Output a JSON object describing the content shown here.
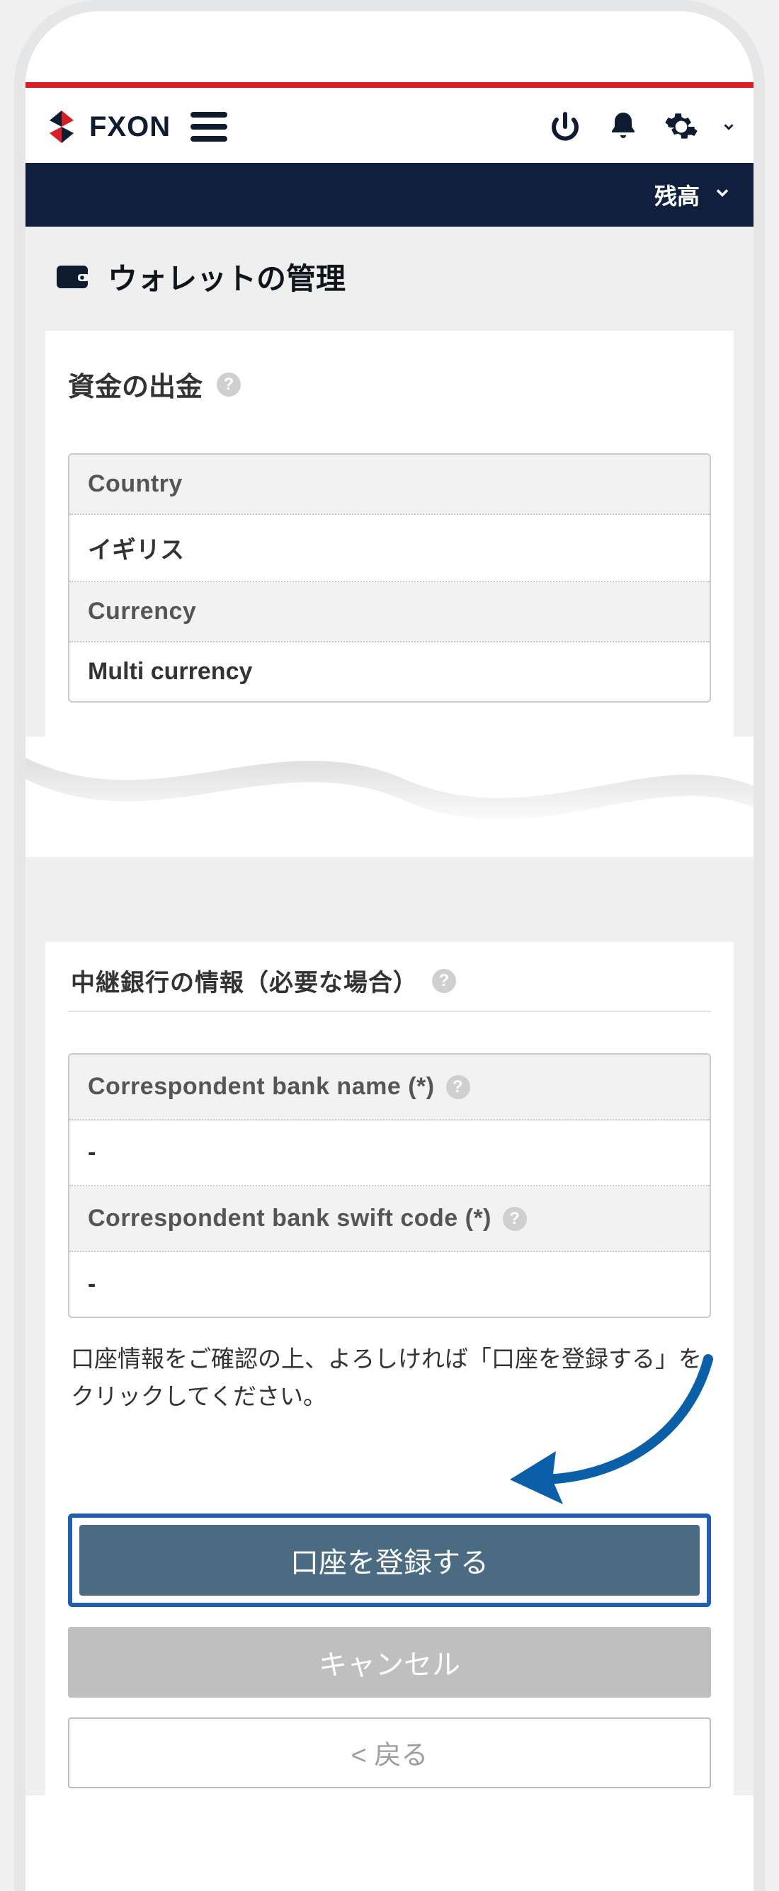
{
  "header": {
    "brand_text": "FXON",
    "balance_label": "残高"
  },
  "page": {
    "title": "ウォレットの管理"
  },
  "withdrawal": {
    "section_title": "資金の出金",
    "rows": {
      "country_label": "Country",
      "country_value": "イギリス",
      "currency_label": "Currency",
      "currency_value": "Multi currency"
    }
  },
  "correspondent": {
    "section_title": "中継銀行の情報（必要な場合）",
    "bank_name_label": "Correspondent bank name (*)",
    "bank_name_value": "-",
    "swift_label": "Correspondent bank swift code (*)",
    "swift_value": "-"
  },
  "confirm_text": "口座情報をご確認の上、よろしければ「口座を登録する」をクリックしてください。",
  "buttons": {
    "register": "口座を登録する",
    "cancel": "キャンセル",
    "back": "< 戻る"
  }
}
